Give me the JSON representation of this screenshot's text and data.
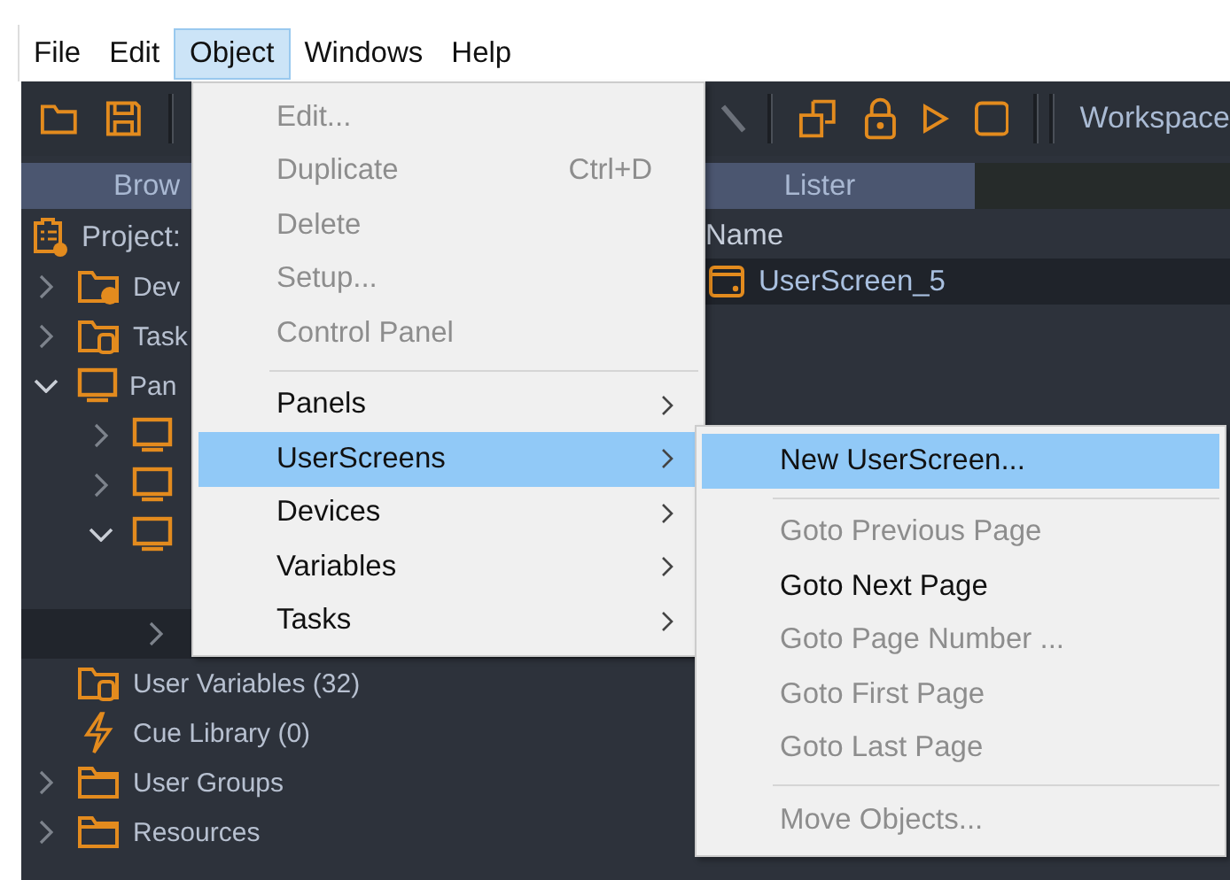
{
  "menubar": [
    {
      "label": "File",
      "selected": false
    },
    {
      "label": "Edit",
      "selected": false
    },
    {
      "label": "Object",
      "selected": true
    },
    {
      "label": "Windows",
      "selected": false
    },
    {
      "label": "Help",
      "selected": false
    }
  ],
  "toolbar": {
    "workspace_label": "Workspace"
  },
  "tabs": [
    {
      "label": "Brow"
    },
    {
      "label": "Lister"
    }
  ],
  "tree": {
    "project_label": "Project:",
    "items": [
      {
        "label": "Dev",
        "kind": "devices",
        "expanded": false,
        "selected": false
      },
      {
        "label": "Task",
        "kind": "tasks",
        "expanded": false,
        "selected": false
      },
      {
        "label": "Pan",
        "kind": "panel",
        "expanded": true,
        "selected": false,
        "children": [
          {
            "kind": "panel",
            "expanded": false,
            "selected": false
          },
          {
            "kind": "panel",
            "expanded": false,
            "selected": false
          },
          {
            "kind": "panel",
            "expanded": true,
            "selected": false,
            "children": [
              {
                "selected": false
              },
              {
                "expanded": false,
                "selected": true
              }
            ]
          }
        ]
      },
      {
        "label": "User Variables (32)",
        "kind": "variables",
        "selected": false
      },
      {
        "label": "Cue Library (0)",
        "kind": "cues",
        "selected": false
      },
      {
        "label": "User Groups",
        "kind": "folder",
        "expanded": false,
        "selected": false
      },
      {
        "label": "Resources",
        "kind": "folder",
        "expanded": false,
        "selected": false
      }
    ]
  },
  "lister": {
    "column": "Name",
    "rows": [
      {
        "label": "UserScreen_5",
        "selected": true
      }
    ]
  },
  "object_menu": {
    "groups": [
      [
        {
          "label": "Edit...",
          "disabled": true,
          "submenu": false,
          "selected": false
        },
        {
          "label": "Duplicate",
          "shortcut": "Ctrl+D",
          "disabled": true,
          "submenu": false,
          "selected": false
        },
        {
          "label": "Delete",
          "disabled": true,
          "submenu": false,
          "selected": false
        },
        {
          "label": "Setup...",
          "disabled": true,
          "submenu": false,
          "selected": false
        },
        {
          "label": "Control Panel",
          "disabled": true,
          "submenu": false,
          "selected": false
        }
      ],
      [
        {
          "label": "Panels",
          "disabled": false,
          "submenu": true,
          "selected": false
        },
        {
          "label": "UserScreens",
          "disabled": false,
          "submenu": true,
          "selected": true
        },
        {
          "label": "Devices",
          "disabled": false,
          "submenu": true,
          "selected": false
        },
        {
          "label": "Variables",
          "disabled": false,
          "submenu": true,
          "selected": false
        },
        {
          "label": "Tasks",
          "disabled": false,
          "submenu": true,
          "selected": false
        }
      ]
    ]
  },
  "userscreens_menu": {
    "groups": [
      [
        {
          "label": "New UserScreen...",
          "disabled": false,
          "submenu": false,
          "selected": true
        }
      ],
      [
        {
          "label": "Goto Previous Page",
          "disabled": true,
          "submenu": false,
          "selected": false
        },
        {
          "label": "Goto Next Page",
          "disabled": false,
          "submenu": false,
          "selected": false
        },
        {
          "label": "Goto Page Number ...",
          "disabled": true,
          "submenu": false,
          "selected": false
        },
        {
          "label": "Goto First Page",
          "disabled": true,
          "submenu": false,
          "selected": false
        },
        {
          "label": "Goto Last Page",
          "disabled": true,
          "submenu": false,
          "selected": false
        }
      ],
      [
        {
          "label": "Move Objects...",
          "disabled": true,
          "submenu": false,
          "selected": false
        }
      ]
    ]
  }
}
